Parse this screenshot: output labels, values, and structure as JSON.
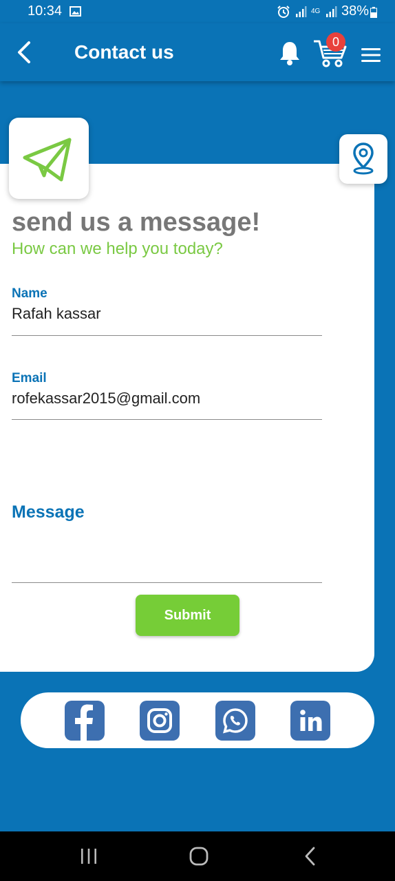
{
  "status_bar": {
    "time": "10:34",
    "network": "4G",
    "battery": "38%"
  },
  "app_bar": {
    "title": "Contact us",
    "cart_count": "0"
  },
  "form": {
    "heading": "send us a message!",
    "subheading": "How can we help you today?",
    "name_label": "Name",
    "name_value": "Rafah kassar",
    "email_label": "Email",
    "email_value": "rofekassar2015@gmail.com",
    "message_label": "Message",
    "message_value": "",
    "submit_label": "Submit"
  },
  "social": [
    {
      "name": "facebook-icon"
    },
    {
      "name": "instagram-icon"
    },
    {
      "name": "whatsapp-icon"
    },
    {
      "name": "linkedin-icon"
    }
  ],
  "colors": {
    "primary": "#0a73b6",
    "accent_green": "#7ac943",
    "submit_green": "#76cd37",
    "badge_red": "#e8413c",
    "social_blue": "#3d6fb0"
  }
}
